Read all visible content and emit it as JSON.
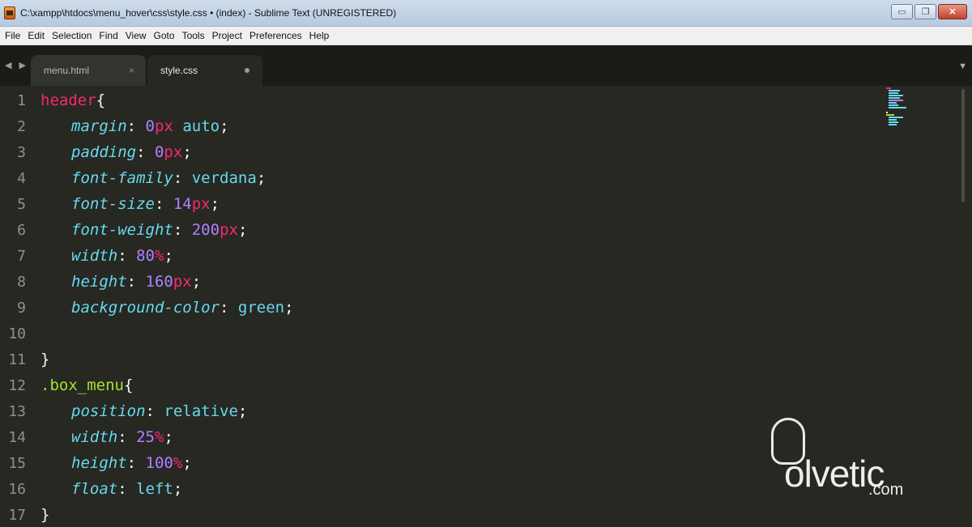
{
  "window": {
    "title": "C:\\xampp\\htdocs\\menu_hover\\css\\style.css • (index) - Sublime Text (UNREGISTERED)",
    "min_glyph": "▭",
    "max_glyph": "❐",
    "close_glyph": "✕"
  },
  "menu": {
    "items": [
      "File",
      "Edit",
      "Selection",
      "Find",
      "View",
      "Goto",
      "Tools",
      "Project",
      "Preferences",
      "Help"
    ]
  },
  "tabs": {
    "nav_arrows": "◀ ▶",
    "dropdown_glyph": "▼",
    "items": [
      {
        "label": "menu.html",
        "close": "×"
      },
      {
        "label": "style.css"
      }
    ]
  },
  "editor": {
    "line_numbers": [
      "1",
      "2",
      "3",
      "4",
      "5",
      "6",
      "7",
      "8",
      "9",
      "10",
      "11",
      "12",
      "13",
      "14",
      "15",
      "16",
      "17"
    ],
    "code": {
      "l1_selector": "header",
      "l1_brace": "{",
      "l2_prop": "margin",
      "l2_num": "0",
      "l2_unit": "px",
      "l2_val": " auto",
      "l3_prop": "padding",
      "l3_num": "0",
      "l3_unit": "px",
      "l4_prop": "font-family",
      "l4_val": "verdana",
      "l5_prop": "font-size",
      "l5_num": "14",
      "l5_unit": "px",
      "l6_prop": "font-weight",
      "l6_num": "200",
      "l6_unit": "px",
      "l7_prop": "width",
      "l7_num": "80",
      "l7_unit": "%",
      "l8_prop": "height",
      "l8_num": "160",
      "l8_unit": "px",
      "l9_prop": "background-color",
      "l9_val": "green",
      "l11_brace": "}",
      "l12_selector": ".box_menu",
      "l12_brace": "{",
      "l13_prop": "position",
      "l13_val": "relative",
      "l14_prop": "width",
      "l14_num": "25",
      "l14_unit": "%",
      "l15_prop": "height",
      "l15_num": "100",
      "l15_unit": "%",
      "l16_prop": "float",
      "l16_val": "left",
      "l17_brace": "}",
      "colon": ": ",
      "semicolon": ";"
    }
  },
  "watermark": {
    "brand": "olvetic",
    "suffix": ".com"
  },
  "colors": {
    "background": "#272822",
    "selector": "#f92672",
    "class_selector": "#a6e22e",
    "property": "#66d9ef",
    "number": "#ae81ff",
    "unit": "#f92672",
    "value": "#66d9ef"
  }
}
